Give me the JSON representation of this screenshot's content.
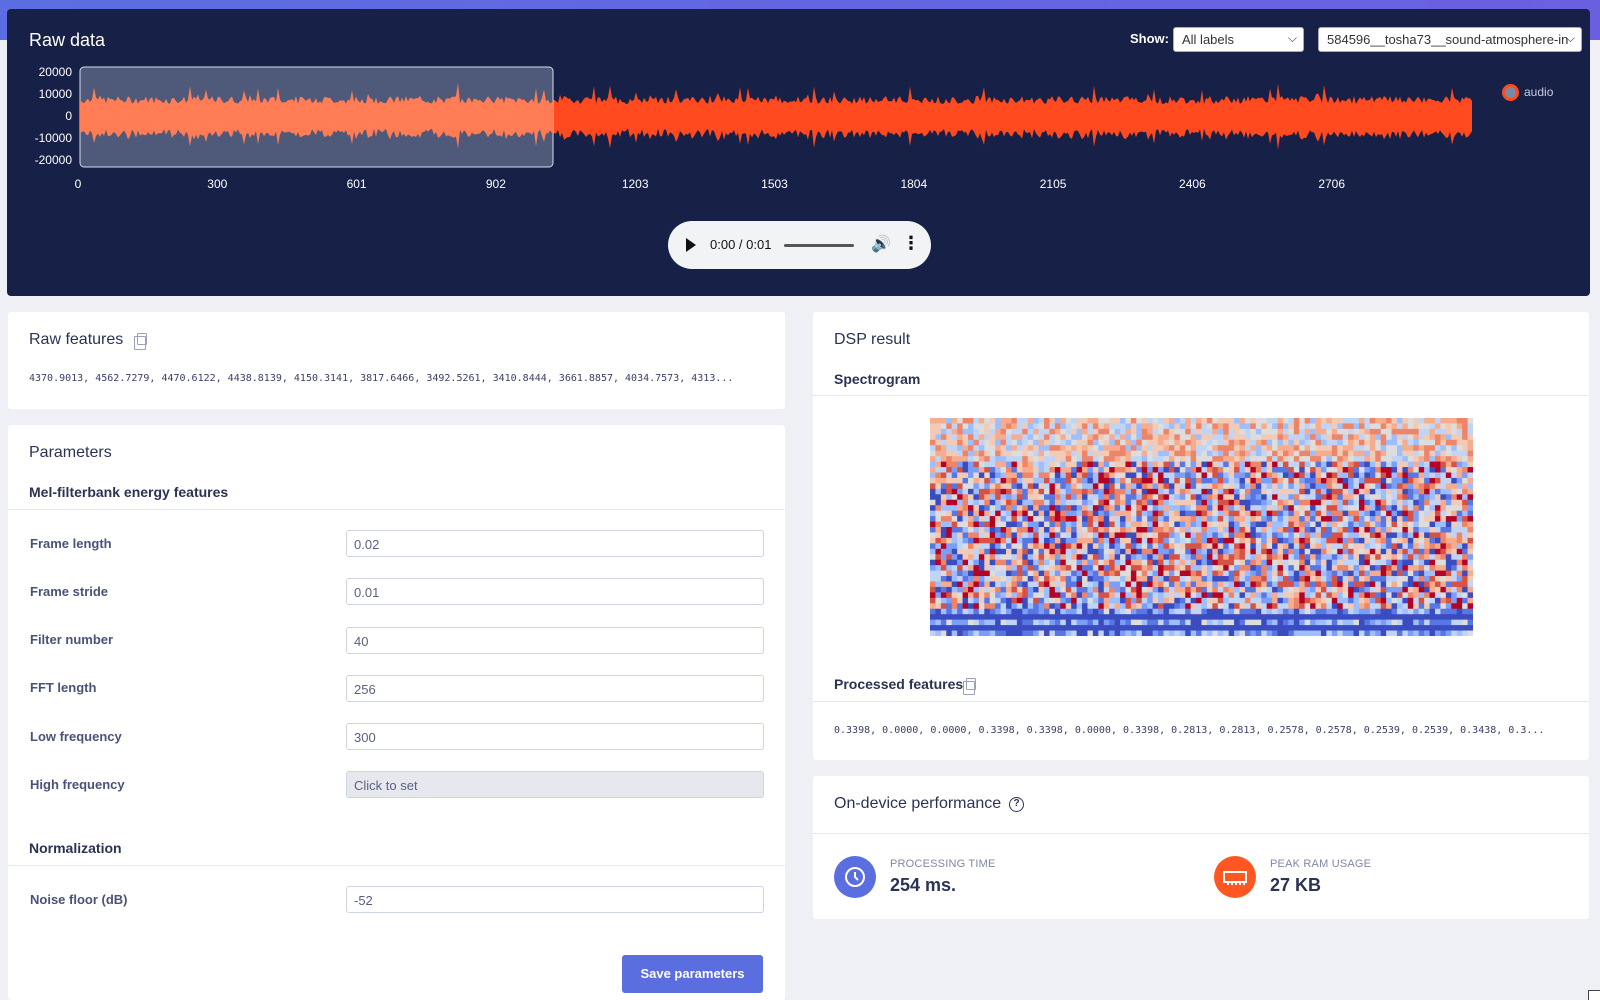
{
  "raw_data": {
    "title": "Raw data",
    "show_label": "Show:",
    "label_filter": "All labels",
    "sample_select": "584596__tosha73__sound-atmosphere-in",
    "legend": "audio",
    "y_ticks": [
      "20000",
      "10000",
      "0",
      "-10000",
      "-20000"
    ],
    "x_ticks": [
      "0",
      "300",
      "601",
      "902",
      "1203",
      "1503",
      "1804",
      "2105",
      "2406",
      "2706"
    ],
    "audio_time": "0:00 / 0:01",
    "colors": {
      "waveform": "#ff4a1f",
      "window": "#ff7c55",
      "panel": "#172046"
    }
  },
  "chart_data": {
    "type": "line",
    "series": [
      {
        "name": "audio",
        "description_range": [
          -12000,
          12000
        ]
      }
    ],
    "ylim": [
      -20000,
      20000
    ],
    "xlim": [
      0,
      3000
    ],
    "window": [
      0,
      1000
    ]
  },
  "raw_features": {
    "title": "Raw features",
    "values": "4370.9013, 4562.7279, 4470.6122, 4438.8139, 4150.3141, 3817.6466, 3492.5261, 3410.8444, 3661.8857, 4034.7573, 4313..."
  },
  "parameters": {
    "title": "Parameters",
    "section1": "Mel-filterbank energy features",
    "fields": [
      {
        "label": "Frame length",
        "value": "0.02"
      },
      {
        "label": "Frame stride",
        "value": "0.01"
      },
      {
        "label": "Filter number",
        "value": "40"
      },
      {
        "label": "FFT length",
        "value": "256"
      },
      {
        "label": "Low frequency",
        "value": "300"
      },
      {
        "label": "High frequency",
        "value": "Click to set"
      }
    ],
    "section2": "Normalization",
    "noise_floor": {
      "label": "Noise floor (dB)",
      "value": "-52"
    },
    "save_label": "Save parameters"
  },
  "dsp": {
    "title": "DSP result",
    "spectrogram_title": "Spectrogram",
    "processed_title": "Processed features",
    "processed_values": "0.3398, 0.0000, 0.0000, 0.3398, 0.3398, 0.0000, 0.3398, 0.2813, 0.2813, 0.2578, 0.2578, 0.2539, 0.2539, 0.3438, 0.3..."
  },
  "performance": {
    "title": "On-device performance",
    "processing_label": "PROCESSING TIME",
    "processing_value": "254 ms.",
    "ram_label": "PEAK RAM USAGE",
    "ram_value": "27 KB",
    "colors": {
      "processing": "#5a6ee0",
      "ram": "#ff5722"
    }
  }
}
